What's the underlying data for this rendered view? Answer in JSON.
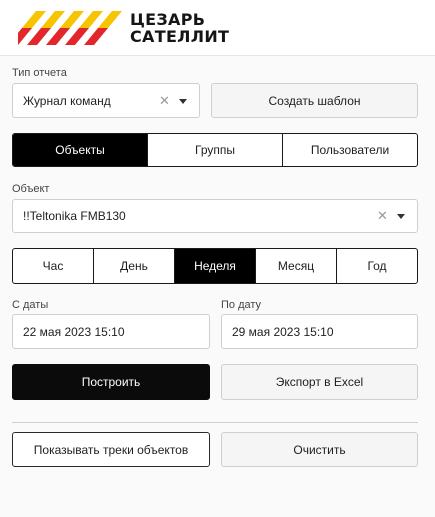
{
  "brand": {
    "line1": "ЦЕЗАРЬ",
    "line2": "САТЕЛЛИТ",
    "stripe_colors": [
      "#f6c400",
      "#e3262b"
    ]
  },
  "report_type": {
    "label": "Тип отчета",
    "value": "Журнал команд",
    "clear_icon": "close-icon",
    "caret_icon": "chevron-down-icon"
  },
  "create_template_label": "Создать шаблон",
  "entity_tabs": {
    "items": [
      "Объекты",
      "Группы",
      "Пользователи"
    ],
    "active": "Объекты"
  },
  "object": {
    "label": "Объект",
    "value": "!!Teltonika FMB130"
  },
  "period_tabs": {
    "items": [
      "Час",
      "День",
      "Неделя",
      "Месяц",
      "Год"
    ],
    "active": "Неделя"
  },
  "date_from": {
    "label": "С даты",
    "value": "22 мая 2023 15:10"
  },
  "date_to": {
    "label": "По дату",
    "value": "29 мая 2023 15:10"
  },
  "build_label": "Построить",
  "export_label": "Экспорт в Excel",
  "show_tracks_label": "Показывать треки объектов",
  "clear_label": "Очистить",
  "colors": {
    "accent": "#000000",
    "border": "#cfcfcf",
    "background": "#fafafa"
  }
}
